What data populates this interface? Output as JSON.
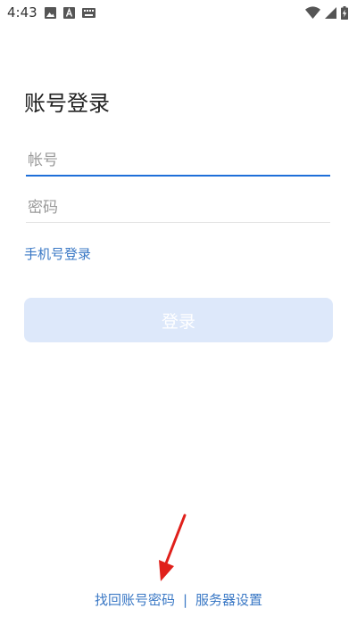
{
  "status_bar": {
    "time": "4:43",
    "left_icons": [
      "image-icon",
      "text-a-icon",
      "keyboard-icon"
    ],
    "right_icons": [
      "wifi-icon",
      "signal-icon",
      "battery-charging-icon"
    ]
  },
  "login": {
    "title": "账号登录",
    "account_placeholder": "帐号",
    "password_placeholder": "密码",
    "phone_login_link": "手机号登录",
    "login_button_label": "登录"
  },
  "footer": {
    "find_account_password": "找回账号密码",
    "separator": "|",
    "server_settings": "服务器设置"
  },
  "colors": {
    "accent": "#3a78c5",
    "input_focus_underline": "#1e6fd9",
    "input_underline": "#e3e3e3",
    "button_disabled_bg": "#dde8fa",
    "annotation_arrow": "#e0201b"
  }
}
